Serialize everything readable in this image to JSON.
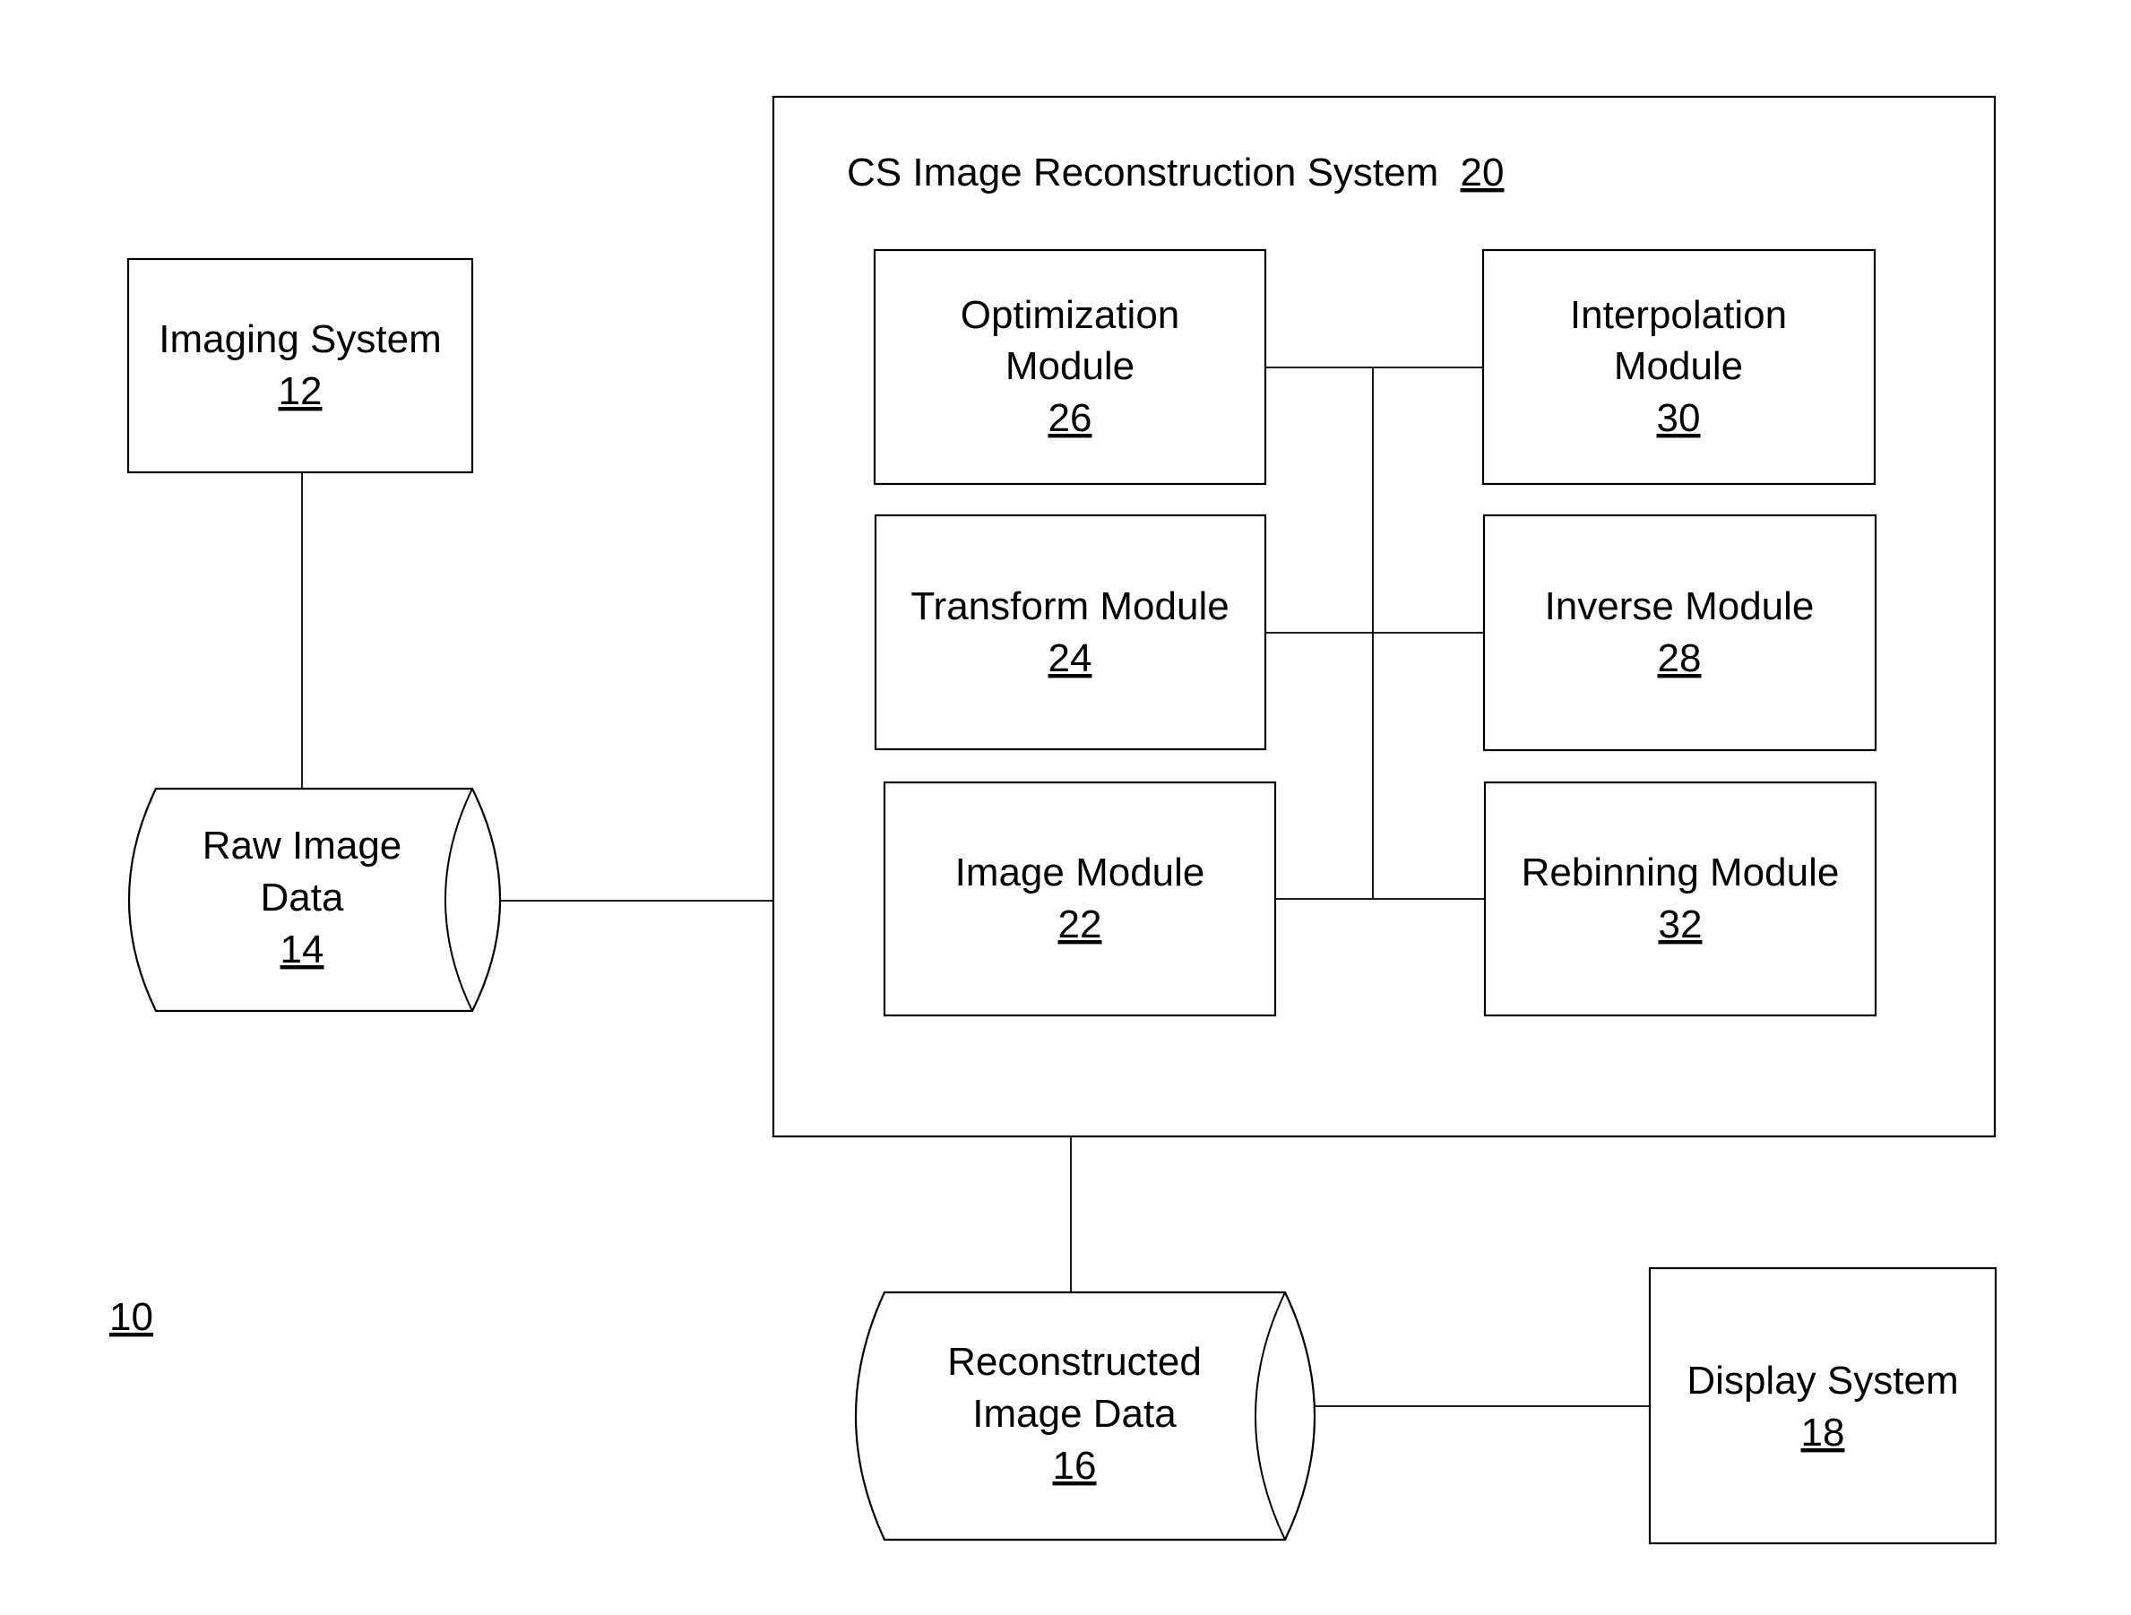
{
  "figure_ref": "10",
  "container": {
    "title": "CS Image Reconstruction System",
    "ref": "20"
  },
  "nodes": {
    "imaging_system": {
      "lines": [
        "Imaging System"
      ],
      "ref": "12",
      "shape": "box"
    },
    "raw_image_data": {
      "lines": [
        "Raw Image",
        "Data"
      ],
      "ref": "14",
      "shape": "cylinder"
    },
    "reconstructed_image_data": {
      "lines": [
        "Reconstructed",
        "Image Data"
      ],
      "ref": "16",
      "shape": "cylinder"
    },
    "display_system": {
      "lines": [
        "Display System"
      ],
      "ref": "18",
      "shape": "box"
    },
    "image_module": {
      "lines": [
        "Image Module"
      ],
      "ref": "22",
      "shape": "box"
    },
    "transform_module": {
      "lines": [
        "Transform Module"
      ],
      "ref": "24",
      "shape": "box"
    },
    "optimization_module": {
      "lines": [
        "Optimization",
        "Module"
      ],
      "ref": "26",
      "shape": "box"
    },
    "inverse_module": {
      "lines": [
        "Inverse Module"
      ],
      "ref": "28",
      "shape": "box"
    },
    "interpolation_module": {
      "lines": [
        "Interpolation",
        "Module"
      ],
      "ref": "30",
      "shape": "box"
    },
    "rebinning_module": {
      "lines": [
        "Rebinning Module"
      ],
      "ref": "32",
      "shape": "box"
    }
  },
  "connections": [
    [
      "imaging_system",
      "raw_image_data"
    ],
    [
      "raw_image_data",
      "cs_image_reconstruction_system"
    ],
    [
      "cs_image_reconstruction_system",
      "reconstructed_image_data"
    ],
    [
      "reconstructed_image_data",
      "display_system"
    ],
    [
      "optimization_module",
      "interpolation_module"
    ],
    [
      "transform_module",
      "inverse_module"
    ],
    [
      "image_module",
      "rebinning_module"
    ],
    [
      "optimization_module",
      "image_module"
    ]
  ]
}
